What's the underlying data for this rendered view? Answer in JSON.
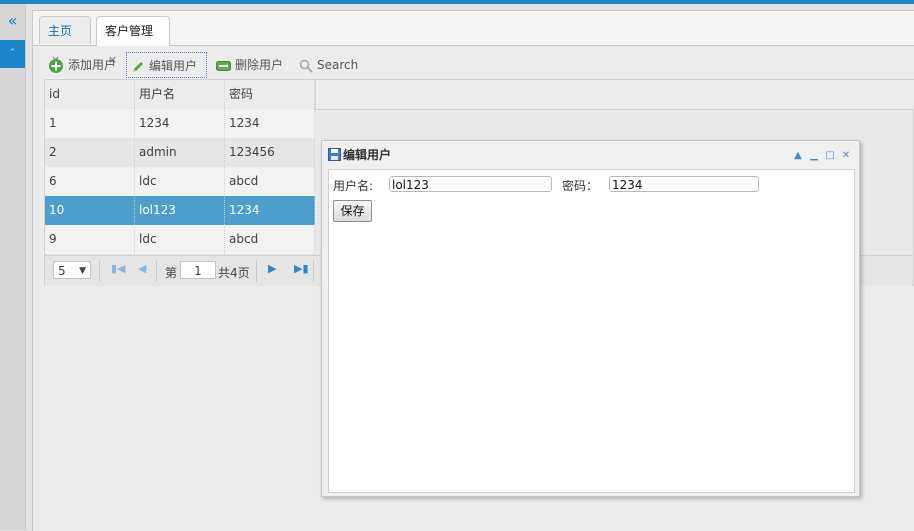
{
  "sidebar": {
    "collapse_glyph": "«",
    "selected_glyph": "⌃"
  },
  "tabs": [
    {
      "label": "主页",
      "close": "×"
    },
    {
      "label": "客户管理",
      "close": "×"
    }
  ],
  "toolbar": {
    "add_label": "添加用户",
    "edit_label": "编辑用户",
    "delete_label": "删除用户",
    "search_label": "Search"
  },
  "table": {
    "columns": [
      "id",
      "用户名",
      "密码"
    ],
    "rows": [
      [
        "1",
        "1234",
        "1234"
      ],
      [
        "2",
        "admin",
        "123456"
      ],
      [
        "6",
        "ldc",
        "abcd"
      ],
      [
        "10",
        "lol123",
        "1234"
      ],
      [
        "9",
        "ldc",
        "abcd"
      ]
    ],
    "selected_row": 3
  },
  "pager": {
    "page_size": "5",
    "page_prefix": "第",
    "page_value": "1",
    "page_total": "共4页"
  },
  "dialog": {
    "title": "编辑用户",
    "username_label": "用户名:",
    "username_value": "lol123",
    "password_label": "密码：",
    "password_value": "1234",
    "save_label": "保存"
  },
  "colors": {
    "accent": "#1e86c6",
    "selected_row": "#4c9fcc"
  }
}
